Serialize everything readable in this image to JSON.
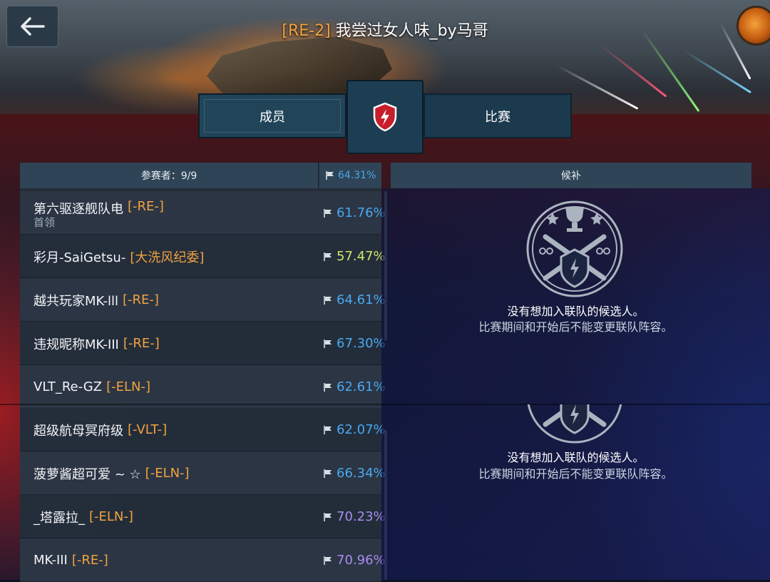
{
  "header": {
    "title_tag": "[RE-2]",
    "title_name": " 我尝过女人味_by马哥"
  },
  "tabs": {
    "members": "成员",
    "battles": "比赛"
  },
  "columns": {
    "participants": "参赛者：9/9",
    "team_rate": "64.31%",
    "reserve": "候补"
  },
  "players": [
    {
      "name": "第六驱逐舰队电",
      "clan": "[-RE-]",
      "role": "首领",
      "rate": "61.76%",
      "rate_color": "#4aa8f0"
    },
    {
      "name": "彩月-SaiGetsu-",
      "clan": "[大洗风纪委]",
      "role": "",
      "rate": "57.47%",
      "rate_color": "#cfe86a"
    },
    {
      "name": "越共玩家MK-lll",
      "clan": "[-RE-]",
      "role": "",
      "rate": "64.61%",
      "rate_color": "#4aa8f0"
    },
    {
      "name": "违规昵称MK-III",
      "clan": "[-RE-]",
      "role": "",
      "rate": "67.30%",
      "rate_color": "#4aa8f0"
    },
    {
      "name": "VLT_Re-GZ",
      "clan": "[-ELN-]",
      "role": "",
      "rate": "62.61%",
      "rate_color": "#4aa8f0"
    },
    {
      "name": "超级航母冥府级",
      "clan": "[-VLT-]",
      "role": "",
      "rate": "62.07%",
      "rate_color": "#4aa8f0"
    },
    {
      "name": "菠萝酱超可爱 ~ ☆",
      "clan": "[-ELN-]",
      "role": "",
      "rate": "66.34%",
      "rate_color": "#4aa8f0"
    },
    {
      "name": "_塔露拉_",
      "clan": "[-ELN-]",
      "role": "",
      "rate": "70.23%",
      "rate_color": "#a98bf0"
    },
    {
      "name": "MK-III",
      "clan": "[-RE-]",
      "role": "",
      "rate": "70.96%",
      "rate_color": "#a98bf0"
    }
  ],
  "reserve_empty": {
    "line1": "没有想加入联队的候选人。",
    "line2": "比赛期间和开始后不能变更联队阵容。"
  },
  "icons": {
    "back": "back-arrow-icon",
    "center": "clan-shield-icon",
    "flag": "flag-icon",
    "emblem": "tournament-emblem-icon",
    "badge": "video-camera-icon"
  }
}
